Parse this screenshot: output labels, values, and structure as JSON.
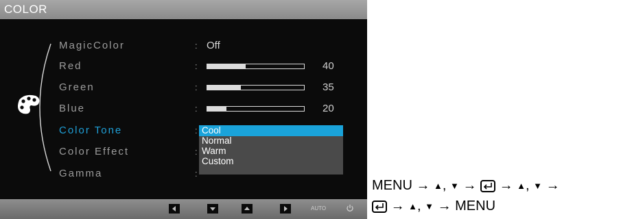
{
  "osd": {
    "title": "COLOR",
    "menu": [
      {
        "label": "MagicColor",
        "type": "text",
        "value": "Off"
      },
      {
        "label": "Red",
        "type": "bar",
        "value": "40",
        "level": 40
      },
      {
        "label": "Green",
        "type": "bar",
        "value": "35",
        "level": 35
      },
      {
        "label": "Blue",
        "type": "bar",
        "value": "20",
        "level": 20
      },
      {
        "label": "Color Tone",
        "type": "dropdown",
        "selected": true
      },
      {
        "label": "Color Effect",
        "type": "none"
      },
      {
        "label": "Gamma",
        "type": "none"
      }
    ],
    "colon": ":",
    "dropdown_options": [
      "Cool",
      "Normal",
      "Warm",
      "Custom"
    ],
    "dropdown_selected": "Cool",
    "bottom_controls": [
      "left-arrow-icon",
      "down-arrow-icon",
      "up-arrow-icon",
      "right-arrow-icon",
      "AUTO",
      "power-icon"
    ],
    "auto_label": "AUTO",
    "colors": {
      "highlight": "#1aa3da",
      "text": "#9c9c9c",
      "background": "#0b0b0b"
    }
  },
  "instructions": {
    "menu": "MENU",
    "arrow": "→",
    "up": "▲",
    "down": "▼",
    "comma": ","
  }
}
